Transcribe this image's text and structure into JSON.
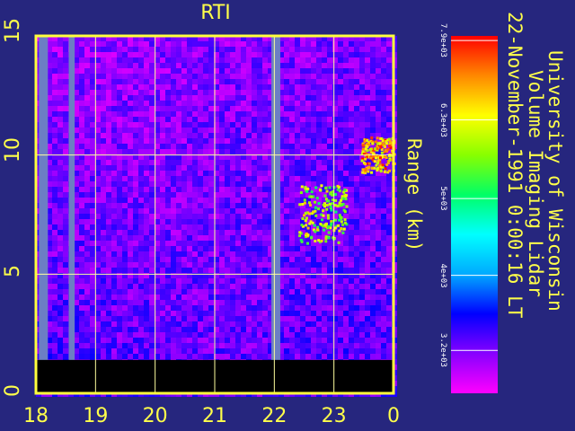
{
  "chart_data": {
    "type": "heatmap",
    "title": "RTI",
    "ylabel": "Range (km)",
    "xlabel": "",
    "x_ticks": [
      "18",
      "19",
      "20",
      "21",
      "22",
      "23",
      "0"
    ],
    "y_ticks": [
      "0",
      "5",
      "10",
      "15"
    ],
    "xlim": [
      18,
      24
    ],
    "ylim": [
      0,
      15
    ],
    "grid": true,
    "no_data_below_km": 1.4,
    "data_gaps_hours": [
      [
        18.05,
        18.2
      ],
      [
        18.55,
        18.65
      ],
      [
        21.95,
        22.1
      ]
    ],
    "features": [
      {
        "x_start": 23.45,
        "x_end": 24,
        "y_start": 9.3,
        "y_end": 10.8,
        "level": 7200
      },
      {
        "x_start": 22.4,
        "x_end": 23.2,
        "y_start": 6.3,
        "y_end": 8.8,
        "level": 6400
      }
    ],
    "colorbar": {
      "ticks": [
        "7.9e+03",
        "6.3e+03",
        "5e+03",
        "4e+03",
        "3.2e+03"
      ],
      "min": 2800,
      "max": 8000,
      "colors": [
        "#ff00ff",
        "#8800ff",
        "#0000ff",
        "#00aaff",
        "#00ffff",
        "#00ff66",
        "#88ff00",
        "#ffff00",
        "#ff8800",
        "#ff0000"
      ]
    }
  },
  "annotation": {
    "institution": "University of Wisconsin",
    "instrument": "Volume Imaging Lidar",
    "datetime": "22-November-1991  0:00:16 LT"
  },
  "colors": {
    "background": "#26267e",
    "text": "#ffff4a",
    "frame": "#ffff3c",
    "gridline": "#ffff9e",
    "gap": "#6c7ec4",
    "nodata": "#000000"
  }
}
